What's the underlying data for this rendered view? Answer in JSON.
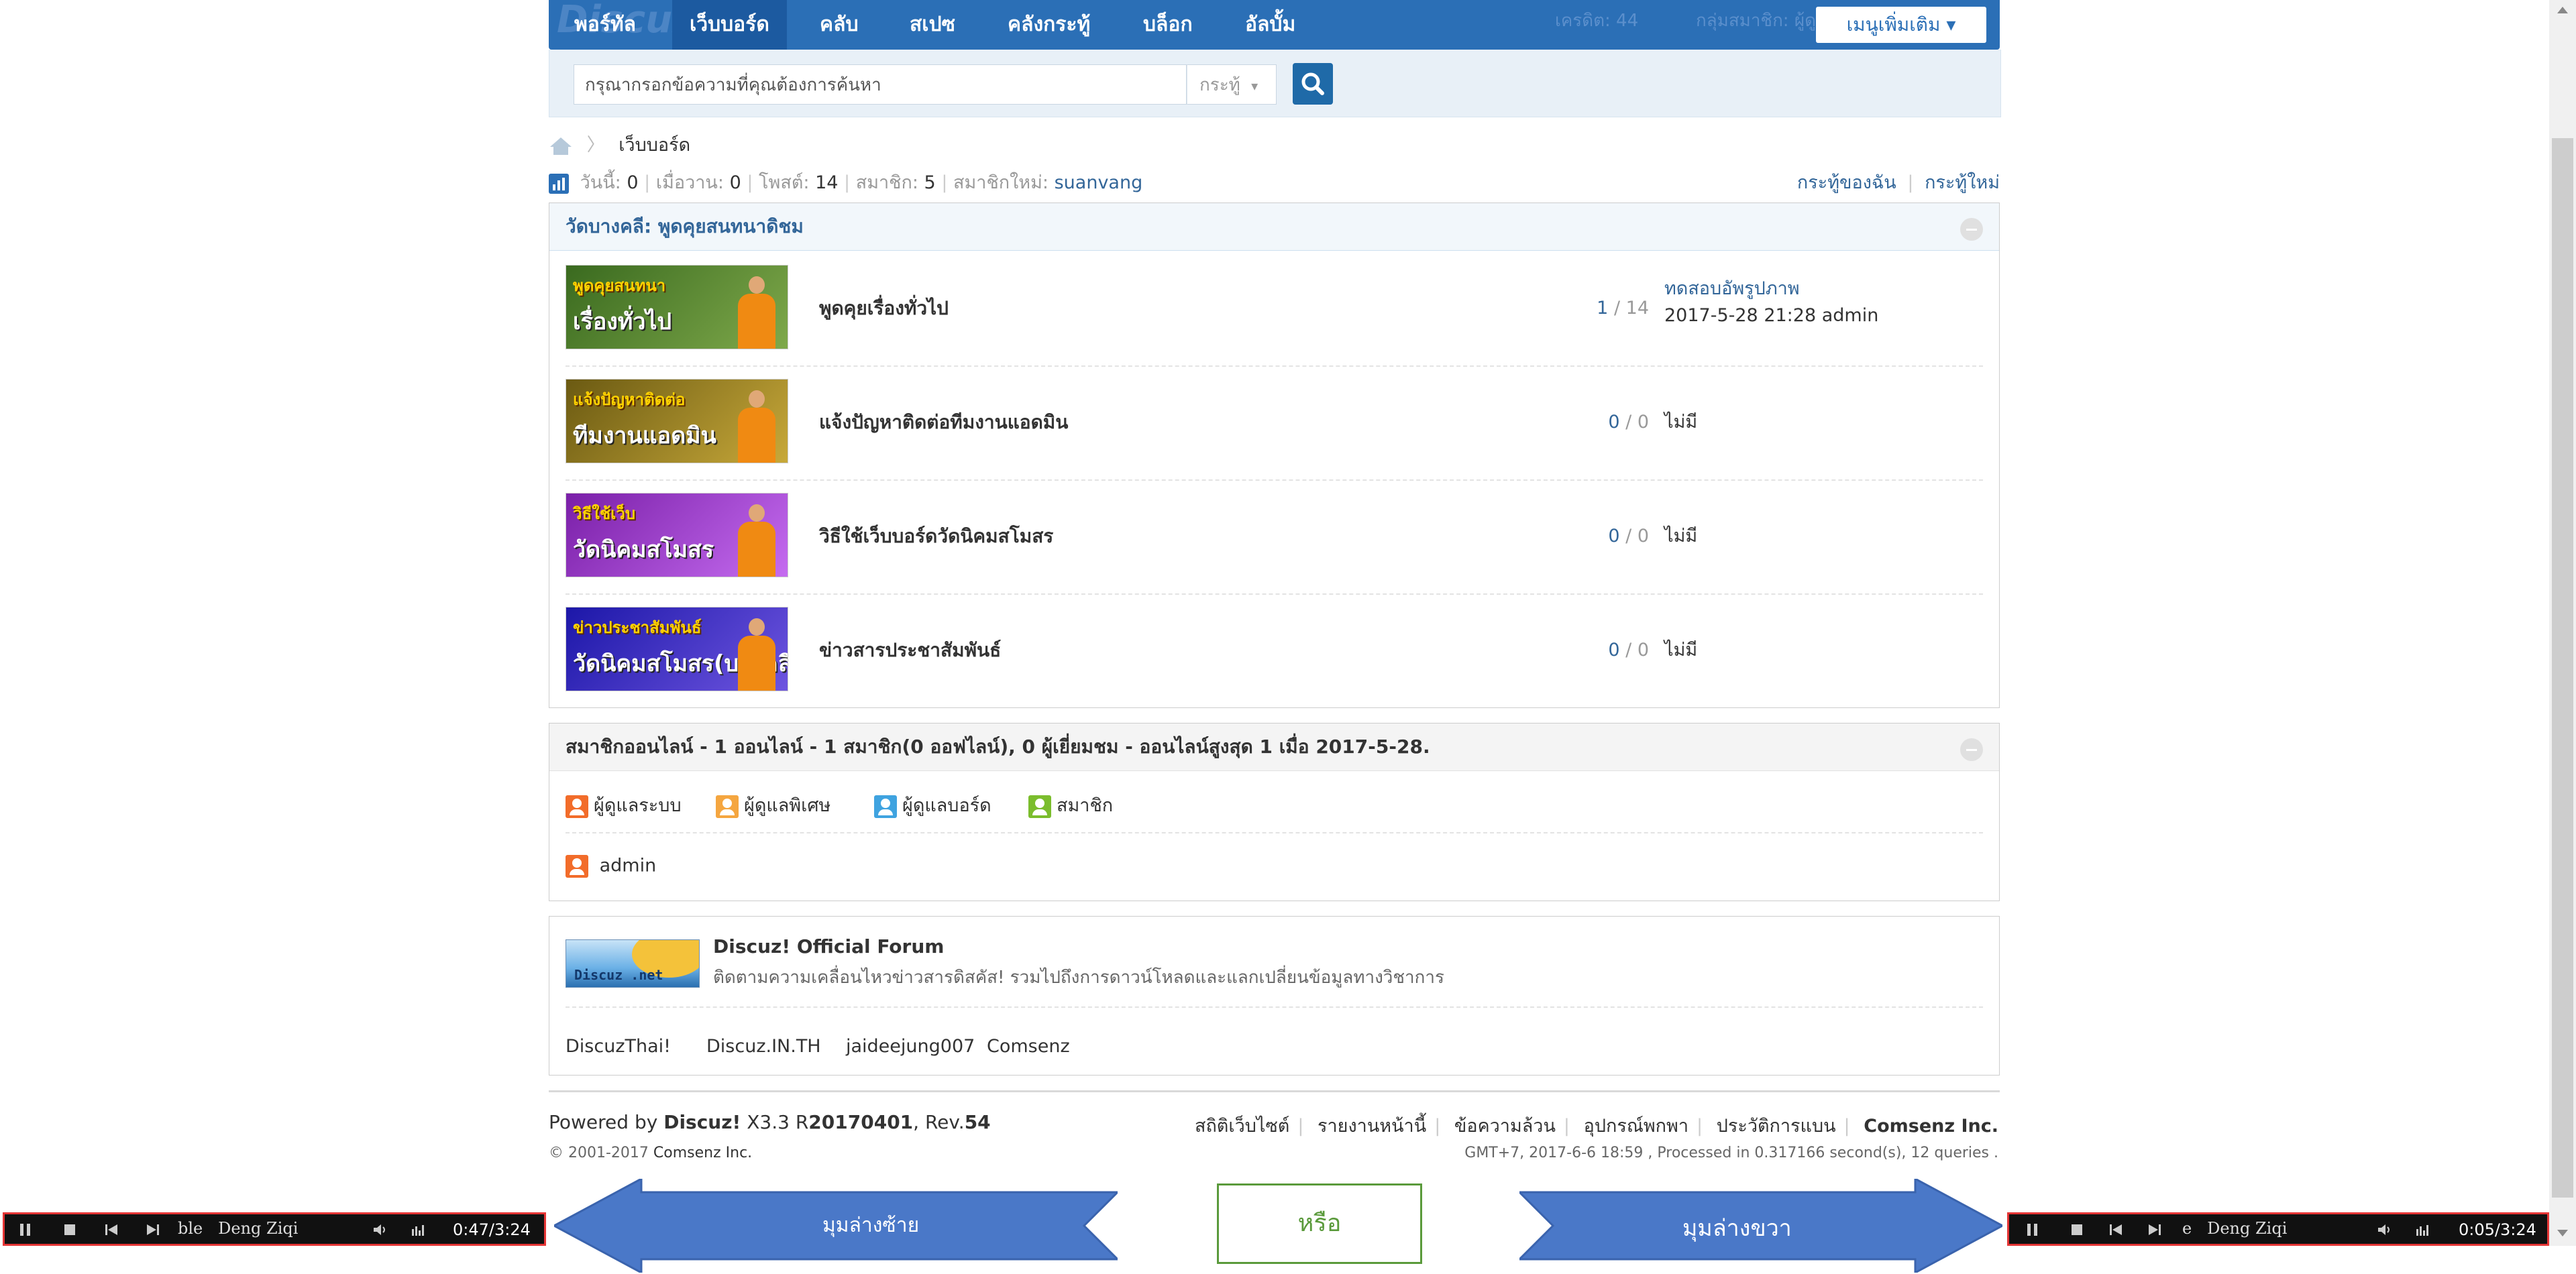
{
  "nav": {
    "logo_text": "Discuz!",
    "items": [
      "พอร์ทัล",
      "เว็บบอร์ด",
      "คลับ",
      "สเปซ",
      "คลังกระทู้",
      "บล็อก",
      "อัลบั้ม"
    ],
    "credit_label": "เครดิต: 44",
    "group_label": "กลุ่มสมาชิก: ผู้ดูแลระบบ",
    "more_menu": "เมนูเพิ่มเติม"
  },
  "search": {
    "placeholder": "กรุณากรอกข้อความที่คุณต้องการค้นหา",
    "type_label": "กระทู้"
  },
  "breadcrumb": {
    "current": "เว็บบอร์ด"
  },
  "stats": {
    "today_label": "วันนี้:",
    "today": "0",
    "yesterday_label": "เมื่อวาน:",
    "yesterday": "0",
    "posts_label": "โพสต์:",
    "posts": "14",
    "members_label": "สมาชิก:",
    "members": "5",
    "newest_label": "สมาชิกใหม่:",
    "newest": "suanvang",
    "my_threads": "กระทู้ของฉัน",
    "new_threads": "กระทู้ใหม่"
  },
  "category": {
    "title": "วัดบางคลี: พูดคุยสนทนาดิชม",
    "forums": [
      {
        "name": "พูดคุยเรื่องทั่วไป",
        "threads": "1",
        "posts": "14",
        "last_title": "ทดสอบอัพรูปภาพ",
        "last_meta": "2017-5-28 21:28 admin",
        "icon_line1": "พูดคุยสนทนา",
        "icon_line2": "เรื่องทั่วไป",
        "icon_color": "#3a6a1f",
        "icon_color2": "#7fa94b"
      },
      {
        "name": "แจ้งปัญหาติดต่อทีมงานแอดมิน",
        "threads": "0",
        "posts": "0",
        "last_title": "ไม่มี",
        "icon_line1": "แจ้งปัญหาติดต่อ",
        "icon_line2": "ทีมงานแอดมิน",
        "icon_color": "#6b5a12",
        "icon_color2": "#c8a93a"
      },
      {
        "name": "วิธีใช้เว็บบอร์ดวัดนิคมสโมสร",
        "threads": "0",
        "posts": "0",
        "last_title": "ไม่มี",
        "icon_line1": "วิธีใช้เว็บ",
        "icon_line2": "วัดนิคมสโมสร",
        "icon_color": "#7a1fa8",
        "icon_color2": "#c56cf0"
      },
      {
        "name": "ข่าวสารประชาสัมพันธ์",
        "threads": "0",
        "posts": "0",
        "last_title": "ไม่มี",
        "icon_line1": "ข่าวประชาสัมพันธ์",
        "icon_line2": "วัดนิคมสโมสร(บางคลี)",
        "icon_color": "#1c17a8",
        "icon_color2": "#6e55e0"
      }
    ]
  },
  "online": {
    "title": "สมาชิกออนไลน์ - 1 ออนไลน์ - 1 สมาชิก(0 ออฟไลน์), 0 ผู้เยี่ยมชม - ออนไลน์สูงสุด 1 เมื่อ 2017-5-28.",
    "legend": [
      {
        "label": "ผู้ดูแลระบบ",
        "color": "#f26c2a"
      },
      {
        "label": "ผู้ดูแลพิเศษ",
        "color": "#f5a640"
      },
      {
        "label": "ผู้ดูแลบอร์ด",
        "color": "#3fa3e0"
      },
      {
        "label": "สมาชิก",
        "color": "#7bbd2d"
      }
    ],
    "users": [
      "admin"
    ]
  },
  "links": {
    "logo_text": "Discuz .net",
    "title": "Discuz! Official Forum",
    "desc": "ติดตามความเคลื่อนไหวข่าวสารดิสคัส! รวมไปถึงการดาวน์โหลดและแลกเปลี่ยนข้อมูลทางวิชาการ",
    "text_links": [
      "DiscuzThai!",
      "Discuz.IN.TH",
      "jaideejung007",
      "Comsenz"
    ]
  },
  "footer": {
    "powered_prefix": "Powered by",
    "product": "Discuz!",
    "version_prefix": "X3.3 R",
    "build": "20170401",
    "rev_prefix": ", Rev.",
    "rev": "54",
    "copyright_prefix": "© 2001-2017",
    "copyright_company": "Comsenz Inc.",
    "links": [
      "สถิติเว็บไซต์",
      "รายงานหน้านี้",
      "ข้อความล้วน",
      "อุปกรณ์พกพา",
      "ประวัติการแบน"
    ],
    "company": "Comsenz Inc.",
    "meta": "GMT+7, 2017-6-6 18:59 , Processed in 0.317166 second(s), 12 queries ."
  },
  "overlay": {
    "left_label": "มุมล่างซ้าย",
    "or_label": "หรือ",
    "right_label": "มุมล่างขวา",
    "left_player": {
      "title": "ble   Deng Ziqi",
      "time": "0:47/3:24"
    },
    "right_player": {
      "title": "e   Deng Ziqi",
      "time": "0:05/3:24"
    }
  }
}
